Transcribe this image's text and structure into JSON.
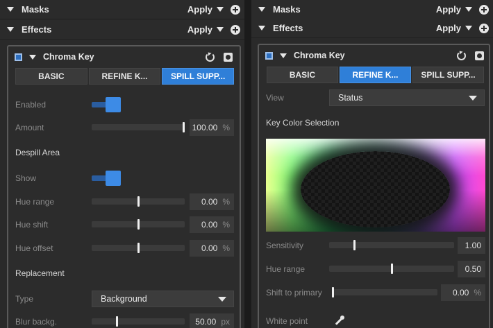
{
  "left": {
    "sections": {
      "masks": "Masks",
      "effects": "Effects",
      "apply": "Apply"
    },
    "effect": {
      "name": "Chroma Key",
      "tabs": [
        "BASIC",
        "REFINE K...",
        "SPILL SUPP..."
      ],
      "active_tab": "SPILL SUPP...",
      "enabled_label": "Enabled",
      "enabled": true,
      "amount_label": "Amount",
      "amount_value": "100.00",
      "amount_level": 1.0,
      "amount_unit": "%",
      "despill_header": "Despill Area",
      "show_label": "Show",
      "show": true,
      "hue_range_label": "Hue range",
      "hue_range_value": "0.00",
      "hue_range_unit": "%",
      "hue_range_level": 0.5,
      "hue_shift_label": "Hue shift",
      "hue_shift_value": "0.00",
      "hue_shift_unit": "%",
      "hue_shift_level": 0.5,
      "hue_offset_label": "Hue offset",
      "hue_offset_value": "0.00",
      "hue_offset_unit": "%",
      "hue_offset_level": 0.5,
      "replacement_header": "Replacement",
      "type_label": "Type",
      "type_value": "Background",
      "blur_label": "Blur backg.",
      "blur_value": "50.00",
      "blur_unit": "px",
      "blur_level": 0.27
    }
  },
  "right": {
    "sections": {
      "masks": "Masks",
      "effects": "Effects",
      "apply": "Apply"
    },
    "effect": {
      "name": "Chroma Key",
      "tabs": [
        "BASIC",
        "REFINE K...",
        "SPILL SUPP..."
      ],
      "active_tab": "REFINE K...",
      "view_label": "View",
      "view_value": "Status",
      "key_color_header": "Key Color Selection",
      "sensitivity_label": "Sensitivity",
      "sensitivity_value": "1.00",
      "sensitivity_level": 0.2,
      "hue_range_label": "Hue range",
      "hue_range_value": "0.50",
      "hue_range_level": 0.5,
      "shift_label": "Shift to primary",
      "shift_value": "0.00",
      "shift_unit": "%",
      "shift_level": 0.0,
      "white_point_label": "White point"
    }
  },
  "colors": {
    "accent": "#2f7fd8",
    "toggle": "#3d8be6",
    "panel": "#2a2a2a"
  },
  "icons": [
    "expand-triangle-icon",
    "add-circle-icon",
    "reset-icon",
    "mask-icon",
    "eyedropper-icon",
    "checkbox-icon"
  ]
}
